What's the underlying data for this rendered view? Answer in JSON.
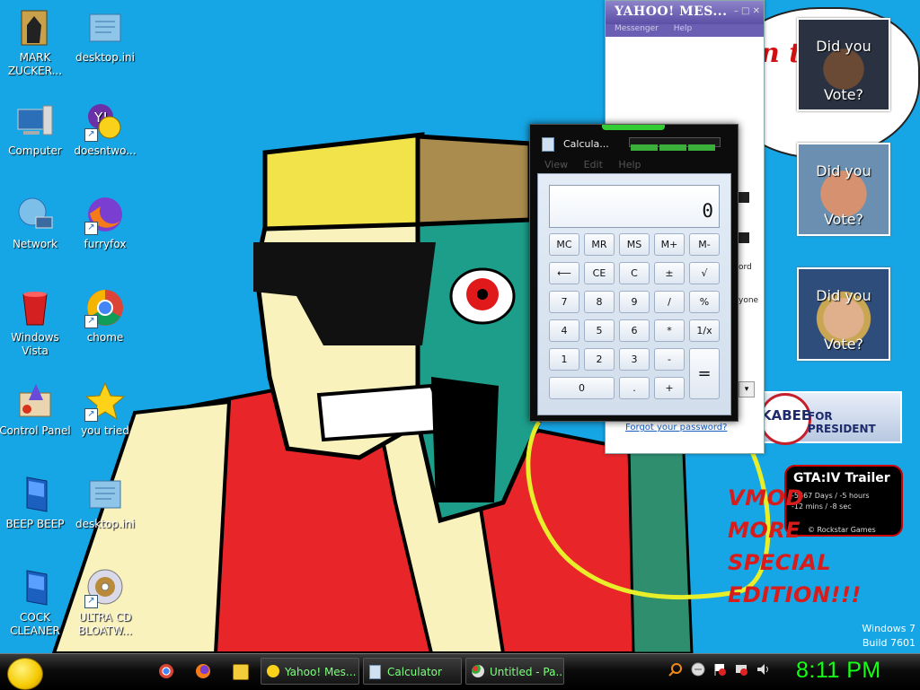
{
  "desktop": {
    "icons": [
      {
        "id": "mark",
        "label": "MARK ZUCKER..."
      },
      {
        "id": "desktopini1",
        "label": "desktop.ini"
      },
      {
        "id": "computer",
        "label": "Computer"
      },
      {
        "id": "doesntwo",
        "label": "doesntwo..."
      },
      {
        "id": "network",
        "label": "Network"
      },
      {
        "id": "furryfox",
        "label": "furryfox"
      },
      {
        "id": "vista",
        "label": "Windows Vista"
      },
      {
        "id": "chome",
        "label": "chome"
      },
      {
        "id": "cpanel",
        "label": "Control Panel"
      },
      {
        "id": "youtried",
        "label": "you tried"
      },
      {
        "id": "beep",
        "label": "BEEP BEEP"
      },
      {
        "id": "desktopini2",
        "label": "desktop.ini"
      },
      {
        "id": "cock",
        "label": "COCK CLEANER"
      },
      {
        "id": "ultra",
        "label": "ULTRA CD BLOATW..."
      }
    ],
    "build_line1": "Windows 7",
    "build_line2": "Build 7601"
  },
  "yahoo_window": {
    "logo": "YAHOO! MES...",
    "menu": [
      "Messenger",
      "Help"
    ],
    "forgot": "Forgot your password?",
    "frag_word": "ord",
    "frag_one": "yone"
  },
  "calculator": {
    "title": "Calcula...",
    "menu": [
      "View",
      "Edit",
      "Help"
    ],
    "display": "0",
    "buttons": {
      "mc": "MC",
      "mr": "MR",
      "ms": "MS",
      "mplus": "M+",
      "mminus": "M-",
      "back": "⟵",
      "ce": "CE",
      "c": "C",
      "pm": "±",
      "sqrt": "√",
      "n7": "7",
      "n8": "8",
      "n9": "9",
      "div": "/",
      "pct": "%",
      "n4": "4",
      "n5": "5",
      "n6": "6",
      "mul": "*",
      "recip": "1/x",
      "n1": "1",
      "n2": "2",
      "n3": "3",
      "sub": "-",
      "eq": "=",
      "n0": "0",
      "dot": ".",
      "add": "+"
    }
  },
  "gadgets": {
    "bubble_text": "n t",
    "vote_top": "Did you",
    "vote_bottom": "Vote?",
    "huckabee_name": "KABEE",
    "huckabee_for": "FOR PRESIDENT",
    "gta_title": "GTA:IV Trailer",
    "gta_line1": "-5667 Days / -5 hours",
    "gta_line2": "-12 mins / -8 sec",
    "gta_credit": "© Rockstar Games",
    "vmod_lines": [
      "VMOD",
      "MORE",
      "SPECIAL",
      "EDITION!!!"
    ]
  },
  "taskbar": {
    "buttons": [
      {
        "label": "Yahoo! Mes..."
      },
      {
        "label": "Calculator"
      },
      {
        "label": "Untitled - Pa..."
      }
    ],
    "clock": "8:11 PM"
  },
  "colors": {
    "desktop": "#16a6e6",
    "clock": "#14ff14",
    "task_text": "#7dff7d"
  }
}
